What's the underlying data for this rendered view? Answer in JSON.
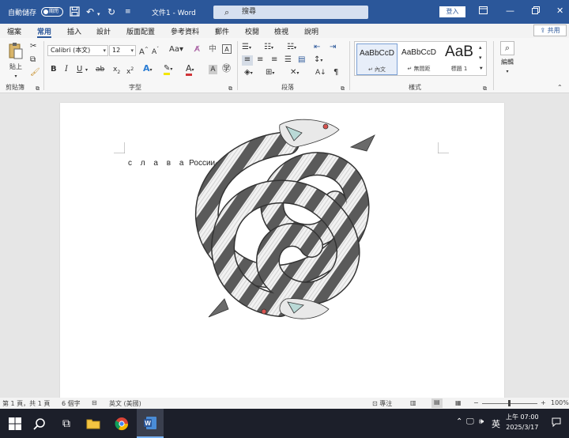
{
  "titlebar": {
    "autosave_label": "自動儲存",
    "autosave_state": "關閉",
    "doc_title": "文件1 - Word",
    "search_placeholder": "搜尋",
    "signin_label": "登入"
  },
  "tabs": [
    "檔案",
    "常用",
    "插入",
    "設計",
    "版面配置",
    "參考資料",
    "郵件",
    "校閱",
    "檢視",
    "說明"
  ],
  "active_tab": "常用",
  "share_label": "共用",
  "ribbon": {
    "clipboard": {
      "paste_label": "貼上",
      "group_label": "剪貼簿"
    },
    "font": {
      "font_name": "Calibri (本文)",
      "font_size": "12",
      "group_label": "字型"
    },
    "paragraph": {
      "group_label": "段落"
    },
    "styles": {
      "group_label": "樣式",
      "items": [
        {
          "sample": "AaBbCcD",
          "name": "內文"
        },
        {
          "sample": "AaBbCcD",
          "name": "無間距"
        },
        {
          "sample": "AaB",
          "name": "標題 1"
        }
      ]
    },
    "editing": {
      "label": "編輯"
    }
  },
  "document": {
    "text_spaced": "с л а в а",
    "text_word": "России"
  },
  "statusbar": {
    "page_info": "第 1 頁，共 1 頁",
    "word_count": "6 個字",
    "language": "英文 (美國)",
    "focus_label": "專注",
    "zoom": "100%"
  },
  "taskbar": {
    "ime": "英",
    "time": "上午 07:00",
    "date": "2025/3/17"
  },
  "colors": {
    "word_blue": "#2b579a",
    "taskbar": "#1c1f2a"
  }
}
